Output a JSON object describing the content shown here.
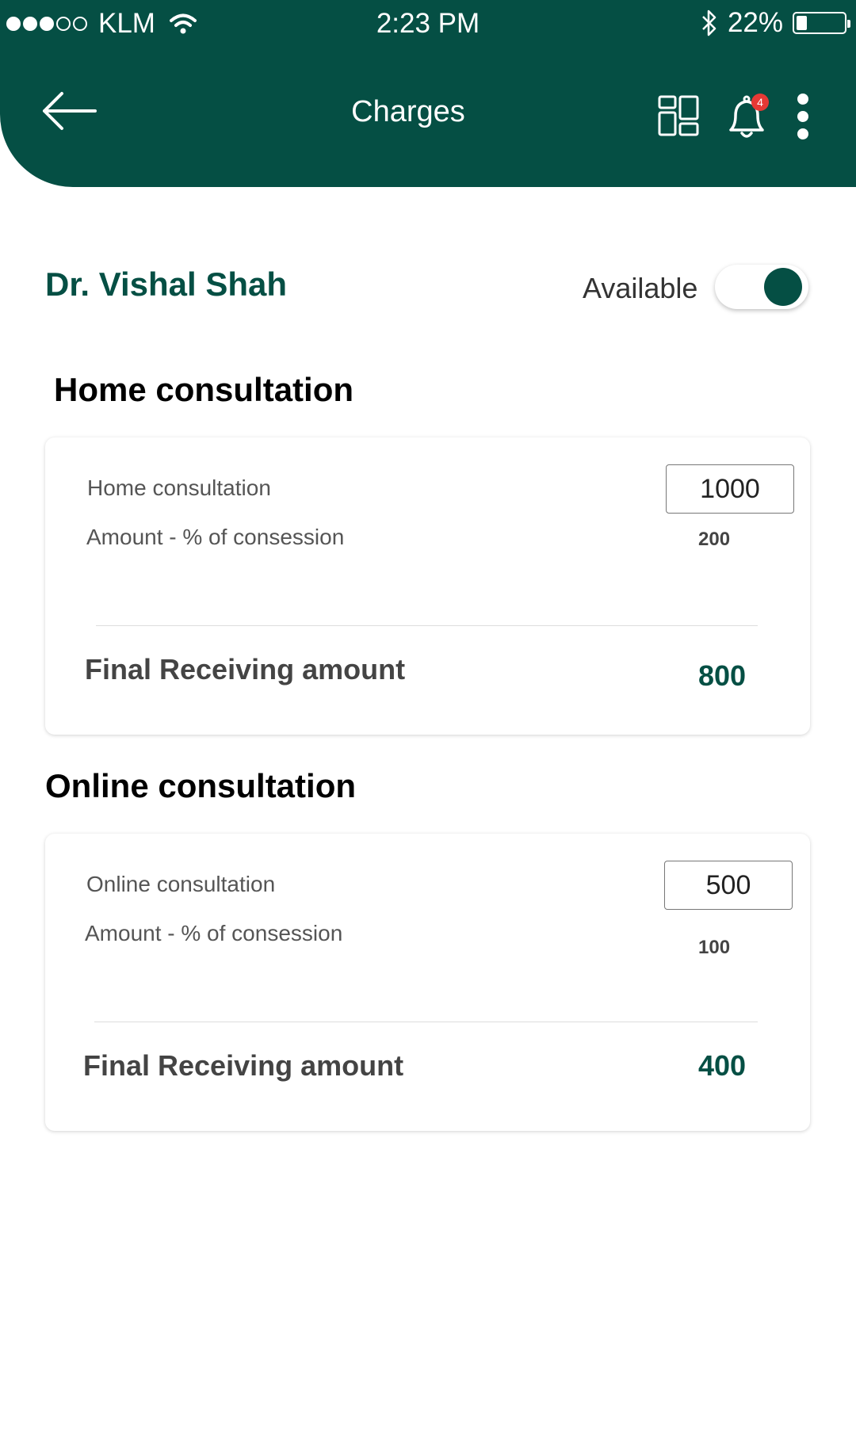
{
  "status_bar": {
    "carrier": "KLM",
    "time": "2:23 PM",
    "battery": "22%",
    "battery_level": 0.22,
    "signal_bars_filled": 3,
    "signal_bars_total": 5
  },
  "header": {
    "title": "Charges",
    "notification_count": "4"
  },
  "doctor": {
    "name": "Dr. Vishal Shah",
    "availability_label": "Available",
    "available": true
  },
  "home": {
    "section_title": "Home consultation",
    "fee_label": "Home consultation",
    "fee_value": "1000",
    "concession_label": "Amount - % of consession",
    "concession_value": "200",
    "final_label": "Final Receiving amount",
    "final_value": "800"
  },
  "online": {
    "section_title": "Online consultation",
    "fee_label": "Online consultation",
    "fee_value": "500",
    "concession_label": "Amount - % of consession",
    "concession_value": "100",
    "final_label": "Final Receiving amount",
    "final_value": "400"
  },
  "colors": {
    "primary": "#054f44",
    "badge": "#e53935"
  }
}
